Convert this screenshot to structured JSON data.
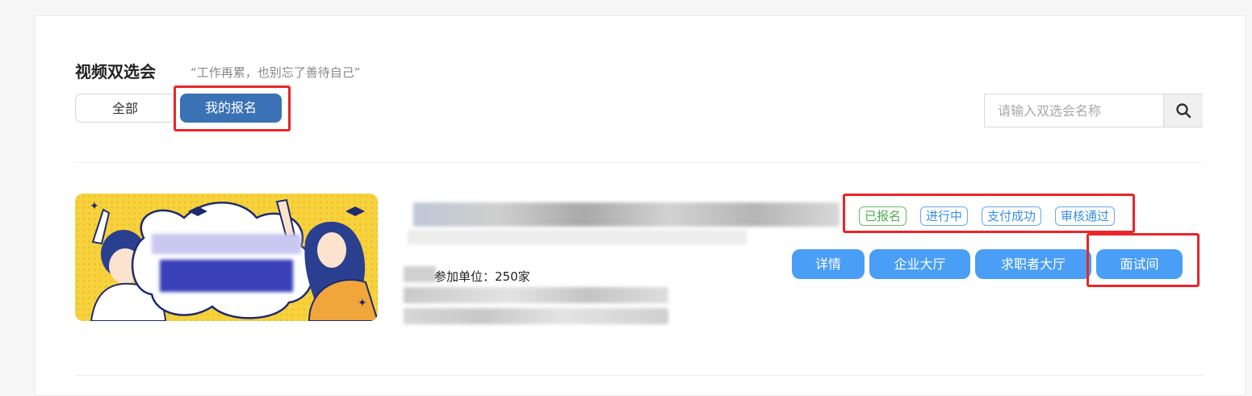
{
  "header": {
    "title": "视频双选会",
    "slogan": "“工作再累，也别忘了善待自己”"
  },
  "tabs": [
    {
      "label": "全部",
      "active": false
    },
    {
      "label": "我的报名",
      "active": true
    }
  ],
  "search": {
    "placeholder": "请输入双选会名称",
    "icon": "search-icon"
  },
  "event": {
    "participants_text": "参加单位：250家",
    "tags": [
      {
        "label": "已报名",
        "color": "#4caf50"
      },
      {
        "label": "进行中",
        "color": "#3a8fe0"
      },
      {
        "label": "支付成功",
        "color": "#3a8fe0"
      },
      {
        "label": "审核通过",
        "color": "#3a8fe0"
      }
    ],
    "actions": [
      {
        "label": "详情"
      },
      {
        "label": "企业大厅"
      },
      {
        "label": "求职者大厅"
      },
      {
        "label": "面试间"
      }
    ]
  },
  "colors": {
    "primary": "#3a72b5",
    "action_button": "#4a9ef5",
    "highlight_box": "#e8262a"
  }
}
